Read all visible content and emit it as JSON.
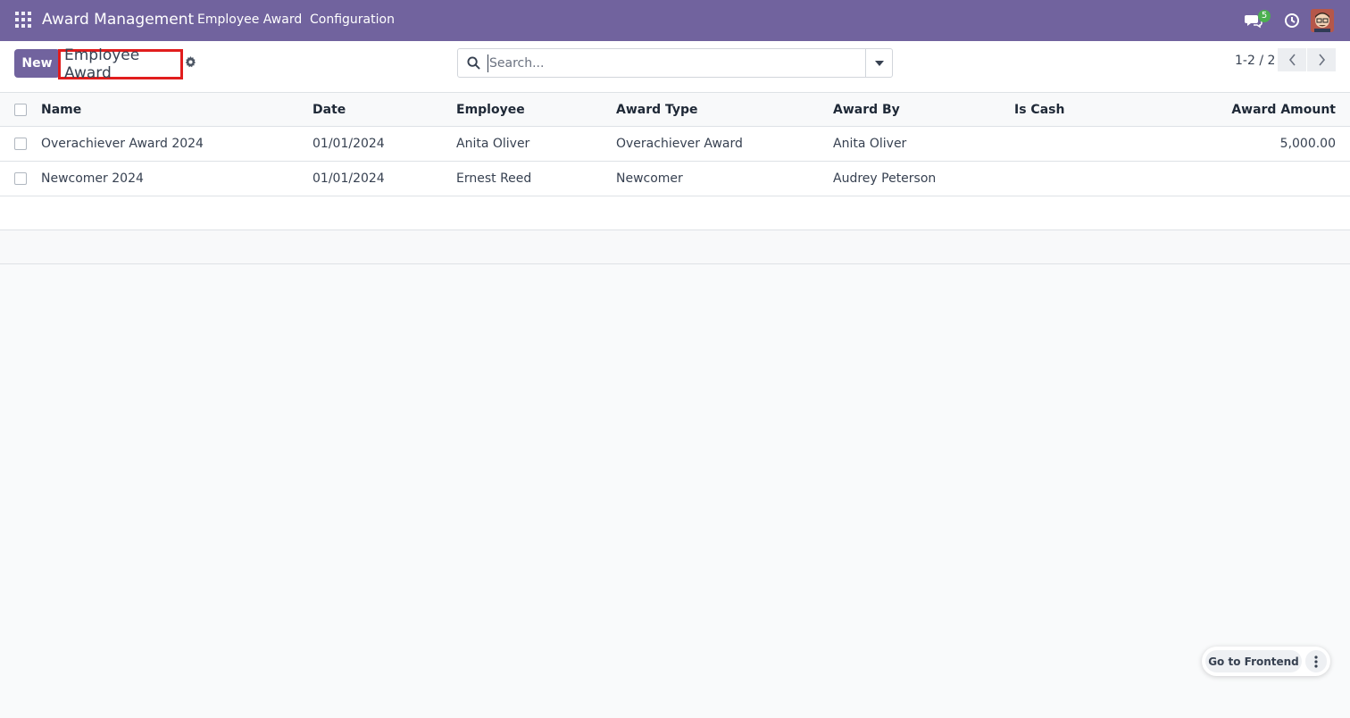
{
  "navbar": {
    "app_name": "Award Management",
    "menu": [
      "Employee Award",
      "Configuration"
    ],
    "message_count": "5"
  },
  "control": {
    "new_label": "New",
    "breadcrumb": "Employee Award",
    "search_placeholder": "Search...",
    "pager": "1-2 / 2"
  },
  "table": {
    "columns": [
      "Name",
      "Date",
      "Employee",
      "Award Type",
      "Award By",
      "Is Cash",
      "Award Amount"
    ],
    "rows": [
      {
        "name": "Overachiever Award 2024",
        "date": "01/01/2024",
        "employee": "Anita Oliver",
        "award_type": "Overachiever Award",
        "award_by": "Anita Oliver",
        "is_cash": "",
        "amount": "5,000.00"
      },
      {
        "name": "Newcomer 2024",
        "date": "01/01/2024",
        "employee": "Ernest Reed",
        "award_type": "Newcomer",
        "award_by": "Audrey Peterson",
        "is_cash": "",
        "amount": ""
      }
    ]
  },
  "floating": {
    "frontend_label": "Go to Frontend"
  },
  "colors": {
    "brand": "#71639e",
    "highlight": "#e11d1d",
    "badge": "#4caf50"
  },
  "icons": [
    "apps-icon",
    "chat-icon",
    "clock-icon",
    "gear-icon",
    "search-icon",
    "caret-down-icon",
    "chevron-left-icon",
    "chevron-right-icon",
    "kebab-icon"
  ]
}
